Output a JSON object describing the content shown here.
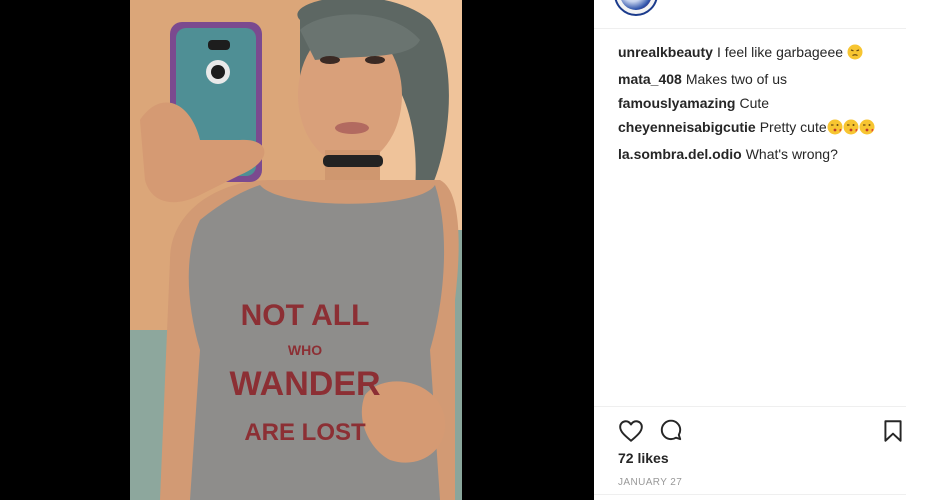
{
  "post": {
    "image_alt": "Mirror selfie photo",
    "shirt_lines": [
      "NOT ALL",
      "WHO",
      "WANDER",
      "ARE LOST"
    ]
  },
  "comments": [
    {
      "username": "unrealkbeauty",
      "text": "I feel like garbageee",
      "emoji": [
        "pensive-face"
      ]
    },
    {
      "username": "mata_408",
      "text": "Makes two of us",
      "emoji": []
    },
    {
      "username": "famouslyamazing",
      "text": "Cute",
      "emoji": []
    },
    {
      "username": "cheyenneisabigcutie",
      "text": "Pretty cute",
      "emoji": [
        "kiss-face",
        "kiss-face",
        "kiss-face"
      ]
    },
    {
      "username": "la.sombra.del.odio",
      "text": "What's wrong?",
      "emoji": []
    }
  ],
  "stats": {
    "likes": "72 likes",
    "date": "JANUARY 27"
  },
  "icons": {
    "like": "heart-icon",
    "comment": "speech-bubble-icon",
    "save": "bookmark-icon"
  },
  "colors": {
    "text": "#262626",
    "muted": "#999999",
    "divider": "#efefef",
    "media_bg": "#000000"
  }
}
